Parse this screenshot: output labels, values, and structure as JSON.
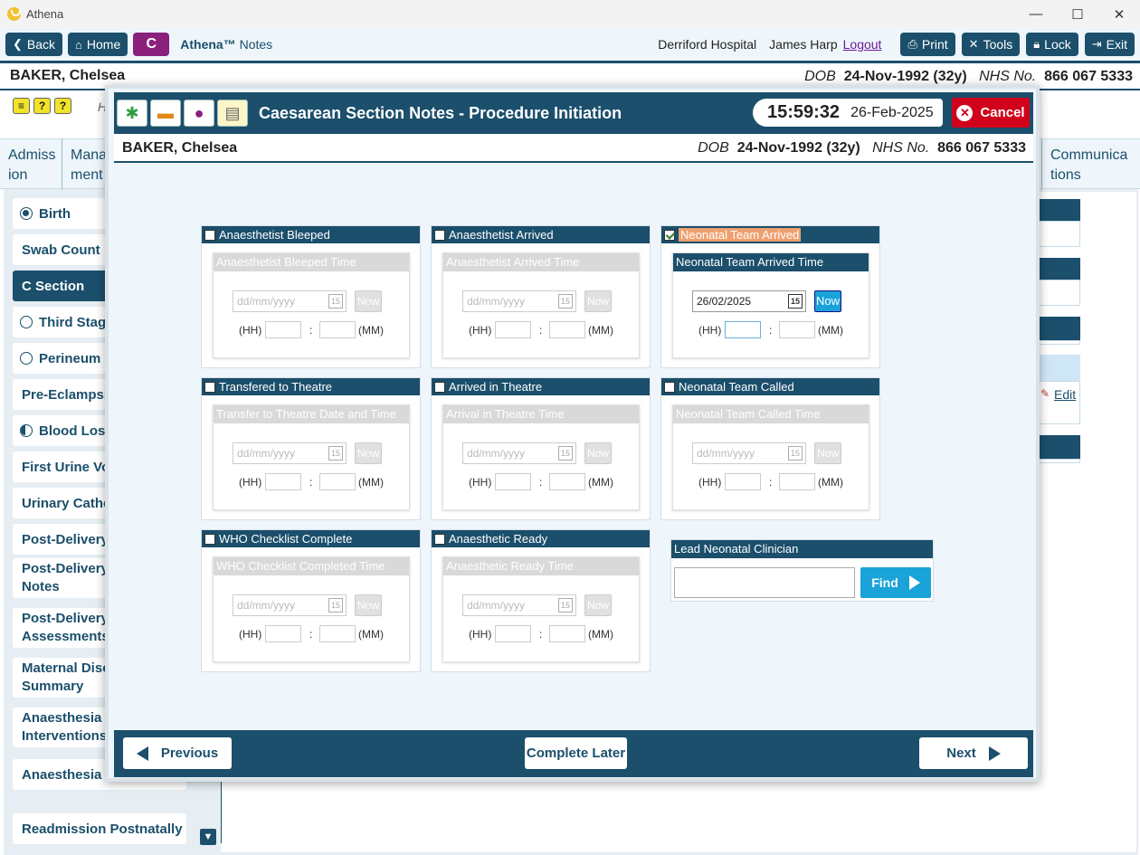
{
  "window": {
    "title": "Athena",
    "controls": [
      "—",
      "☐",
      "✕"
    ]
  },
  "toolbar": {
    "back": "Back",
    "home": "Home",
    "c_label": "C",
    "brand": "Athena™",
    "module": "Notes",
    "hospital": "Derriford Hospital",
    "user": "James Harp",
    "logout": "Logout",
    "print": "Print",
    "tools": "Tools",
    "lock": "Lock",
    "exit": "Exit"
  },
  "patient": {
    "name": "BAKER, Chelsea",
    "dob_label": "DOB",
    "dob": "24-Nov-1992 (32y)",
    "nhs_label": "NHS No.",
    "nhs": "866 067 5333"
  },
  "background": {
    "h_text": "H",
    "tabs": [
      "Admiss\nion",
      "Mana\nment",
      "Communica\ntions"
    ],
    "sidebar": [
      {
        "label": "Birth",
        "radio": "on"
      },
      {
        "label": "Swab Count",
        "radio": "none"
      },
      {
        "label": "C Section",
        "radio": "none",
        "active": true
      },
      {
        "label": "Third Stage",
        "radio": "off"
      },
      {
        "label": "Perineum",
        "radio": "off"
      },
      {
        "label": "Pre-Eclampsia",
        "radio": "none"
      },
      {
        "label": "Blood Loss",
        "radio": "half"
      },
      {
        "label": "First Urine Voi",
        "radio": "none"
      },
      {
        "label": "Urinary Cathe",
        "radio": "none"
      },
      {
        "label": "Post-Delivery",
        "radio": "none"
      },
      {
        "label": "Post-Delivery\nNotes",
        "radio": "none"
      },
      {
        "label": "Post-Delivery\nAssessments",
        "radio": "none"
      },
      {
        "label": "Maternal Disc\nSummary",
        "radio": "none"
      },
      {
        "label": "Anaesthesia\nInterventions",
        "radio": "none"
      },
      {
        "label": "Anaesthesia F",
        "radio": "none"
      },
      {
        "label": "Readmission Postnatally",
        "radio": "none"
      }
    ],
    "edit": "Edit"
  },
  "modal": {
    "title": "Caesarean Section Notes - Procedure Initiation",
    "time": "15:59:32",
    "date": "26-Feb-2025",
    "cancel": "Cancel",
    "date_placeholder": "dd/mm/yyyy",
    "now": "Now",
    "hh": "(HH)",
    "colon": ":",
    "mm": "(MM)",
    "panels": [
      {
        "label": "Anaesthetist Bleeped",
        "checked": false,
        "sub": "Anaesthetist Bleeped Time",
        "date": ""
      },
      {
        "label": "Anaesthetist Arrived",
        "checked": false,
        "sub": "Anaesthetist Arrived Time",
        "date": ""
      },
      {
        "label": "Neonatal Team Arrived",
        "checked": true,
        "sub": "Neonatal Team Arrived Time",
        "date": "26/02/2025"
      },
      {
        "label": "Transfered to Theatre",
        "checked": false,
        "sub": "Transfer to Theatre Date and Time",
        "date": ""
      },
      {
        "label": "Arrived in Theatre",
        "checked": false,
        "sub": "Arrival in Theatre Time",
        "date": ""
      },
      {
        "label": "Neonatal Team Called",
        "checked": false,
        "sub": "Neonatal Team Called Time",
        "date": ""
      },
      {
        "label": "WHO Checklist Complete",
        "checked": false,
        "sub": "WHO Checklist Completed Time",
        "date": ""
      },
      {
        "label": "Anaesthetic Ready",
        "checked": false,
        "sub": "Anaesthetic Ready Time",
        "date": ""
      }
    ],
    "lead_label": "Lead Neonatal Clinician",
    "lead_value": "",
    "find": "Find",
    "previous": "Previous",
    "complete_later": "Complete Later",
    "next": "Next"
  },
  "colors": {
    "primary": "#1b4f6b",
    "accent": "#1aa3d9",
    "cancel": "#d0021b",
    "brand_c": "#8a1f7c",
    "highlight": "#f0a070"
  }
}
